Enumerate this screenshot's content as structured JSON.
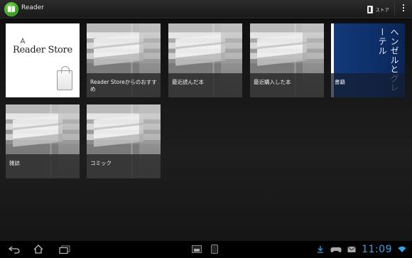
{
  "app": {
    "title": "Reader",
    "store_button_label": "ストア"
  },
  "tiles": [
    {
      "label": "",
      "logo_text": "Reader Store"
    },
    {
      "label": "Reader Storeからのおすすめ"
    },
    {
      "label": "最近読んだ本"
    },
    {
      "label": "最近購入した本"
    },
    {
      "label": "書籍",
      "cover_title": "ヘンゼルとグレーテル"
    },
    {
      "label": "雑誌"
    },
    {
      "label": "コミック"
    }
  ],
  "status": {
    "time": "11:09"
  },
  "colors": {
    "accent_clock": "#35a3e6",
    "app_icon_green": "#2e9a17",
    "book_cover_blue": "#123a7a"
  },
  "icons": {
    "app": "reader-book-icon",
    "store": "store-icon",
    "overflow": "overflow-menu-icon",
    "back": "back-icon",
    "home": "home-icon",
    "recent": "recent-apps-icon",
    "download": "download-icon",
    "gamepad": "gamepad-icon",
    "mail": "mail-icon",
    "wifi": "wifi-icon"
  }
}
